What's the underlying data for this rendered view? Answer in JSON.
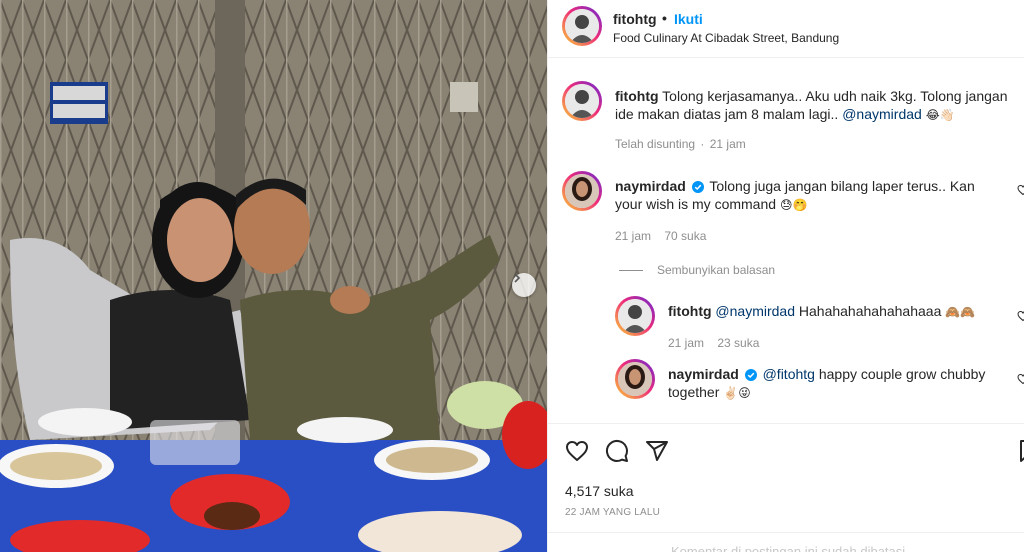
{
  "post": {
    "author": "fitohtg",
    "dot": "•",
    "follow_label": "Ikuti",
    "location": "Food Culinary At Cibadak Street, Bandung",
    "likes_text": "4,517 suka",
    "timestamp": "22 JAM YANG LALU",
    "comments_limited": "Komentar di postingan ini sudah dibatasi"
  },
  "caption": {
    "user": "fitohtg",
    "text": "Tolong kerjasamanya.. Aku udh naik 3kg. Tolong jangan ide makan diatas jam 8 malam lagi..",
    "mention": "@naymirdad",
    "emojis": "😂👋🏻",
    "edited_label": "Telah disunting",
    "time": "21 jam"
  },
  "comments": [
    {
      "user": "naymirdad",
      "verified": true,
      "text": "Tolong juga jangan bilang laper terus.. Kan your wish is my command",
      "emojis": "😓🤭",
      "time": "21 jam",
      "likes": "70 suka"
    }
  ],
  "hide_replies_label": "Sembunyikan balasan",
  "replies": [
    {
      "user": "fitohtg",
      "mention": "@naymirdad",
      "text": "Hahahahahahahahaaa",
      "emojis": "🙈🙈",
      "time": "21 jam",
      "likes": "23 suka"
    },
    {
      "user": "naymirdad",
      "verified": true,
      "mention": "@fitohtg",
      "text": "happy couple grow chubby together",
      "emojis": "✌🏻😜"
    }
  ],
  "icons": {
    "like": "heart-icon",
    "comment": "comment-icon",
    "share": "share-icon",
    "save": "bookmark-icon",
    "next": "chevron-right-icon"
  },
  "colors": {
    "accent": "#0095f6",
    "mention": "#00376b",
    "muted": "#8e8e8e",
    "verified": "#0095f6"
  }
}
